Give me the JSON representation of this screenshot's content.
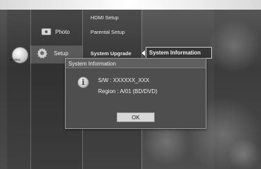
{
  "disc": {
    "label": "No Disc"
  },
  "menu": {
    "items": [
      {
        "label": "Photo",
        "icon": "photo-icon"
      },
      {
        "label": "Setup",
        "icon": "gear-icon",
        "selected": true
      }
    ]
  },
  "submenu": {
    "items": [
      {
        "label": "HDMI Setup"
      },
      {
        "label": "Parental Setup"
      },
      {
        "label": "System Upgrade",
        "selected": true
      }
    ]
  },
  "info_panel": {
    "item_label": "System Information"
  },
  "dialog": {
    "title": "System Information",
    "sw_line": "S/W : XXXXXX_XXX",
    "region_line": "Region : A/01 (BD/DVD)",
    "ok_label": "OK",
    "icon": "info-icon"
  }
}
